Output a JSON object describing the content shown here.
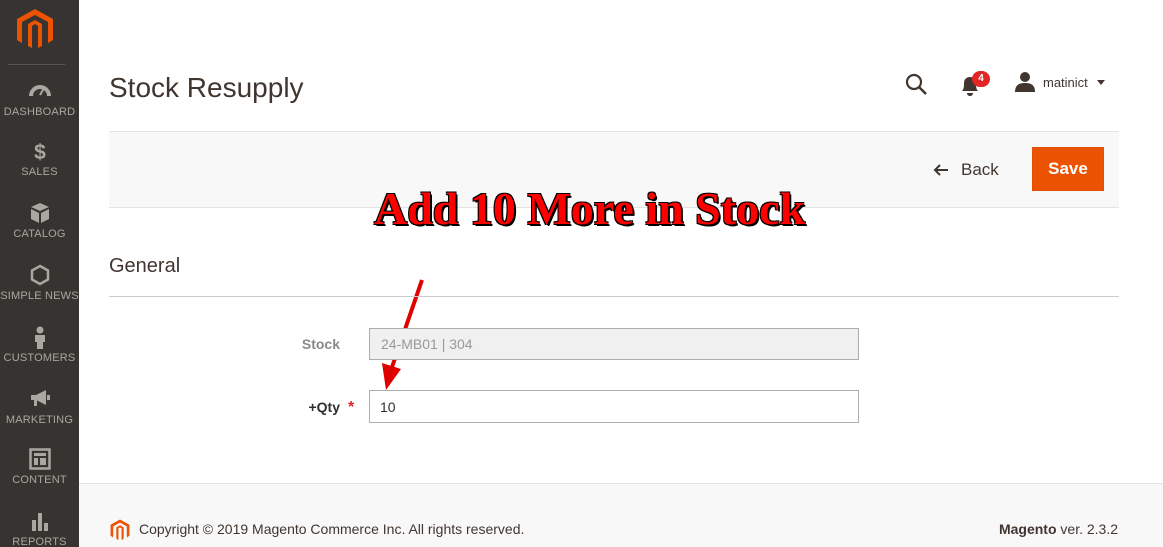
{
  "sidebar": {
    "items": [
      {
        "label": "DASHBOARD",
        "icon": "dashboard-icon"
      },
      {
        "label": "SALES",
        "icon": "dollar-icon"
      },
      {
        "label": "CATALOG",
        "icon": "box-icon"
      },
      {
        "label": "SIMPLE NEWS",
        "icon": "hexagon-icon"
      },
      {
        "label": "CUSTOMERS",
        "icon": "person-icon"
      },
      {
        "label": "MARKETING",
        "icon": "megaphone-icon"
      },
      {
        "label": "CONTENT",
        "icon": "layout-icon"
      },
      {
        "label": "REPORTS",
        "icon": "bar-chart-icon"
      }
    ]
  },
  "header": {
    "title": "Stock Resupply",
    "notification_count": "4",
    "user_name": "matinict"
  },
  "actions": {
    "back_label": "Back",
    "save_label": "Save"
  },
  "annotation": {
    "text": "Add 10 More in Stock"
  },
  "form": {
    "section_title": "General",
    "stock_label": "Stock",
    "stock_value": "24-MB01 | 304",
    "qty_label": "+Qty",
    "required_mark": "*",
    "qty_value": "10"
  },
  "footer": {
    "copyright": "Copyright © 2019 Magento Commerce Inc. All rights reserved.",
    "brand": "Magento",
    "version": " ver. 2.3.2"
  },
  "colors": {
    "sidebar_bg": "#373330",
    "accent": "#eb5202",
    "badge": "#e22626",
    "annotation": "#ff0000"
  }
}
